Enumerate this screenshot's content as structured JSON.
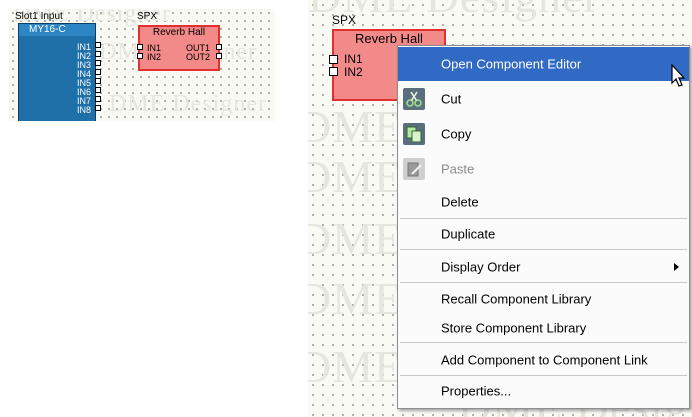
{
  "watermark": "DME Designer",
  "small_view": {
    "slot_label": "Slot1 Input",
    "spx_label": "SPX",
    "blue_component": {
      "title": "MY16-C",
      "ports": [
        "IN1",
        "IN2",
        "IN3",
        "IN4",
        "IN5",
        "IN6",
        "IN7",
        "IN8"
      ]
    },
    "red_component": {
      "title": "Reverb Hall",
      "inputs": [
        "IN1",
        "IN2"
      ],
      "outputs": [
        "OUT1",
        "OUT2"
      ]
    }
  },
  "large_view": {
    "spx_label": "SPX",
    "red_component": {
      "title": "Reverb Hall",
      "inputs": [
        "IN1",
        "IN2"
      ]
    }
  },
  "context_menu": {
    "items": [
      {
        "label": "Open Component Editor",
        "icon": "",
        "enabled": true,
        "highlighted": true
      },
      {
        "label": "Cut",
        "icon": "scissors-icon",
        "enabled": true
      },
      {
        "label": "Copy",
        "icon": "copy-icon",
        "enabled": true
      },
      {
        "label": "Paste",
        "icon": "paste-icon",
        "enabled": false
      },
      {
        "label": "Delete",
        "enabled": true
      },
      {
        "label": "Duplicate",
        "enabled": true
      },
      {
        "label": "Display Order",
        "enabled": true,
        "submenu": true
      },
      {
        "label": "Recall Component Library",
        "enabled": true
      },
      {
        "label": "Store Component Library",
        "enabled": true
      },
      {
        "label": "Add Component to Component Link",
        "enabled": true
      },
      {
        "label": "Properties...",
        "enabled": true
      }
    ]
  },
  "colors": {
    "blue_component": "#1f6fa8",
    "red_component": "#f28a8a",
    "red_border": "#e0302f",
    "menu_highlight": "#316ac5"
  }
}
